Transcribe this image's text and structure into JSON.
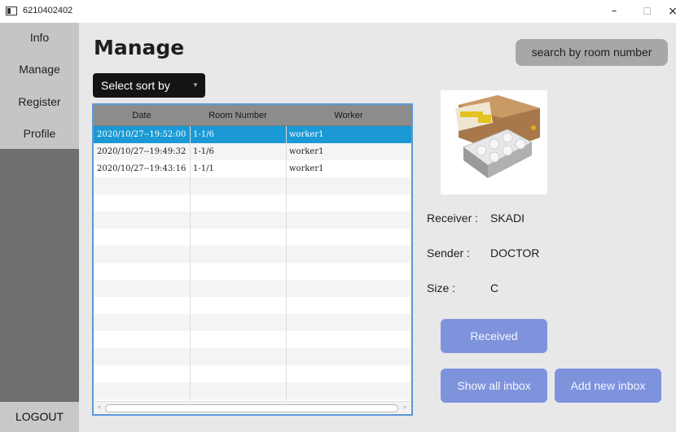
{
  "window": {
    "title": "6210402402",
    "minimize": "–",
    "close": "×"
  },
  "sidebar": {
    "items": [
      {
        "label": "Info"
      },
      {
        "label": "Manage"
      },
      {
        "label": "Register"
      },
      {
        "label": "Profile"
      }
    ],
    "logout": "LOGOUT"
  },
  "main": {
    "title": "Manage",
    "sort_select": {
      "value": "Select sort by",
      "arrow": "▼"
    },
    "search_button": "search by room number"
  },
  "table": {
    "columns": [
      "Date",
      "Room Number",
      "Worker"
    ],
    "rows": [
      {
        "date": "2020/10/27--19:52:00",
        "room": "1-1/6",
        "worker": "worker1",
        "selected": true
      },
      {
        "date": "2020/10/27--19:49:32",
        "room": "1-1/6",
        "worker": "worker1",
        "selected": false
      },
      {
        "date": "2020/10/27--19:43:16",
        "room": "1-1/1",
        "worker": "worker1",
        "selected": false
      }
    ]
  },
  "details": {
    "receiver_label": "Receiver :",
    "receiver_value": "SKADI",
    "sender_label": "Sender :",
    "sender_value": "DOCTOR",
    "size_label": "Size :",
    "size_value": "C"
  },
  "actions": {
    "received": "Received",
    "show_all": "Show all inbox",
    "add_new": "Add new inbox"
  },
  "colors": {
    "accent_button": "#7f93dd",
    "selected_row": "#1a99d4",
    "sidebar_dark": "#6f6f6f"
  }
}
